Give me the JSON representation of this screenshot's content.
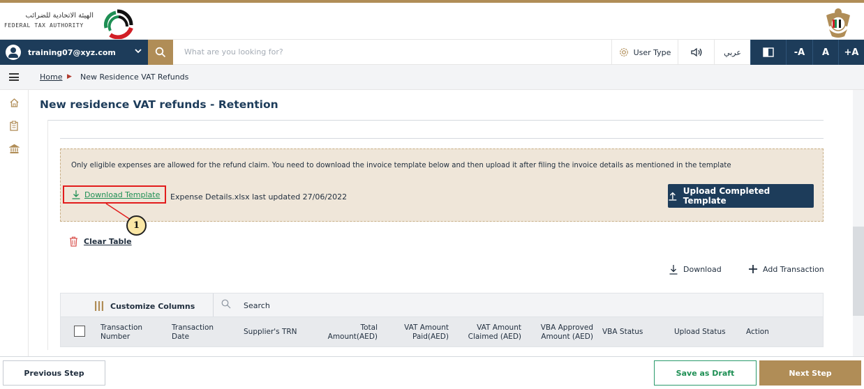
{
  "brand": {
    "name_ar": "الهيئة الاتحادية للضرائب",
    "name_en": "FEDERAL TAX AUTHORITY"
  },
  "toolbar": {
    "user_email": "training07@xyz.com",
    "search_placeholder": "What are you looking for?",
    "user_type": "User Type",
    "language": "عربي",
    "font_decrease": "-A",
    "font_normal": "A",
    "font_increase": "+A"
  },
  "breadcrumb": {
    "home": "Home",
    "current": "New Residence VAT Refunds"
  },
  "page": {
    "title": "New residence VAT refunds - Retention"
  },
  "info_panel": {
    "message": "Only eligible expenses are allowed for the refund claim. You need to download the invoice template below and then upload it after filing the invoice details as mentioned in the template",
    "download_template": "Download Template",
    "file_info": "Expense Details.xlsx last updated 27/06/2022",
    "upload_button": "Upload Completed Template"
  },
  "callout": {
    "number": "1"
  },
  "actions": {
    "clear_table": "Clear Table",
    "download": "Download",
    "add_transaction": "Add Transaction"
  },
  "table": {
    "customize_columns": "Customize Columns",
    "search_label": "Search",
    "columns": {
      "transaction_number": [
        "Transaction",
        "Number"
      ],
      "transaction_date": [
        "Transaction",
        "Date"
      ],
      "supplier_trn": "Supplier's TRN",
      "total_amount": [
        "Total",
        "Amount(AED)"
      ],
      "vat_paid": [
        "VAT Amount",
        "Paid(AED)"
      ],
      "vat_claimed": [
        "VAT Amount",
        "Claimed (AED)"
      ],
      "vba_approved": [
        "VBA Approved",
        "Amount (AED)"
      ],
      "vba_status": "VBA Status",
      "upload_status": "Upload Status",
      "action": "Action"
    }
  },
  "footer": {
    "previous": "Previous Step",
    "save_draft": "Save as Draft",
    "next": "Next Step"
  },
  "colors": {
    "navy": "#1d3c5a",
    "gold": "#b08d57",
    "green": "#1e8f54",
    "red_highlight": "#e21c1c",
    "panel_bg": "#efe6d9"
  }
}
